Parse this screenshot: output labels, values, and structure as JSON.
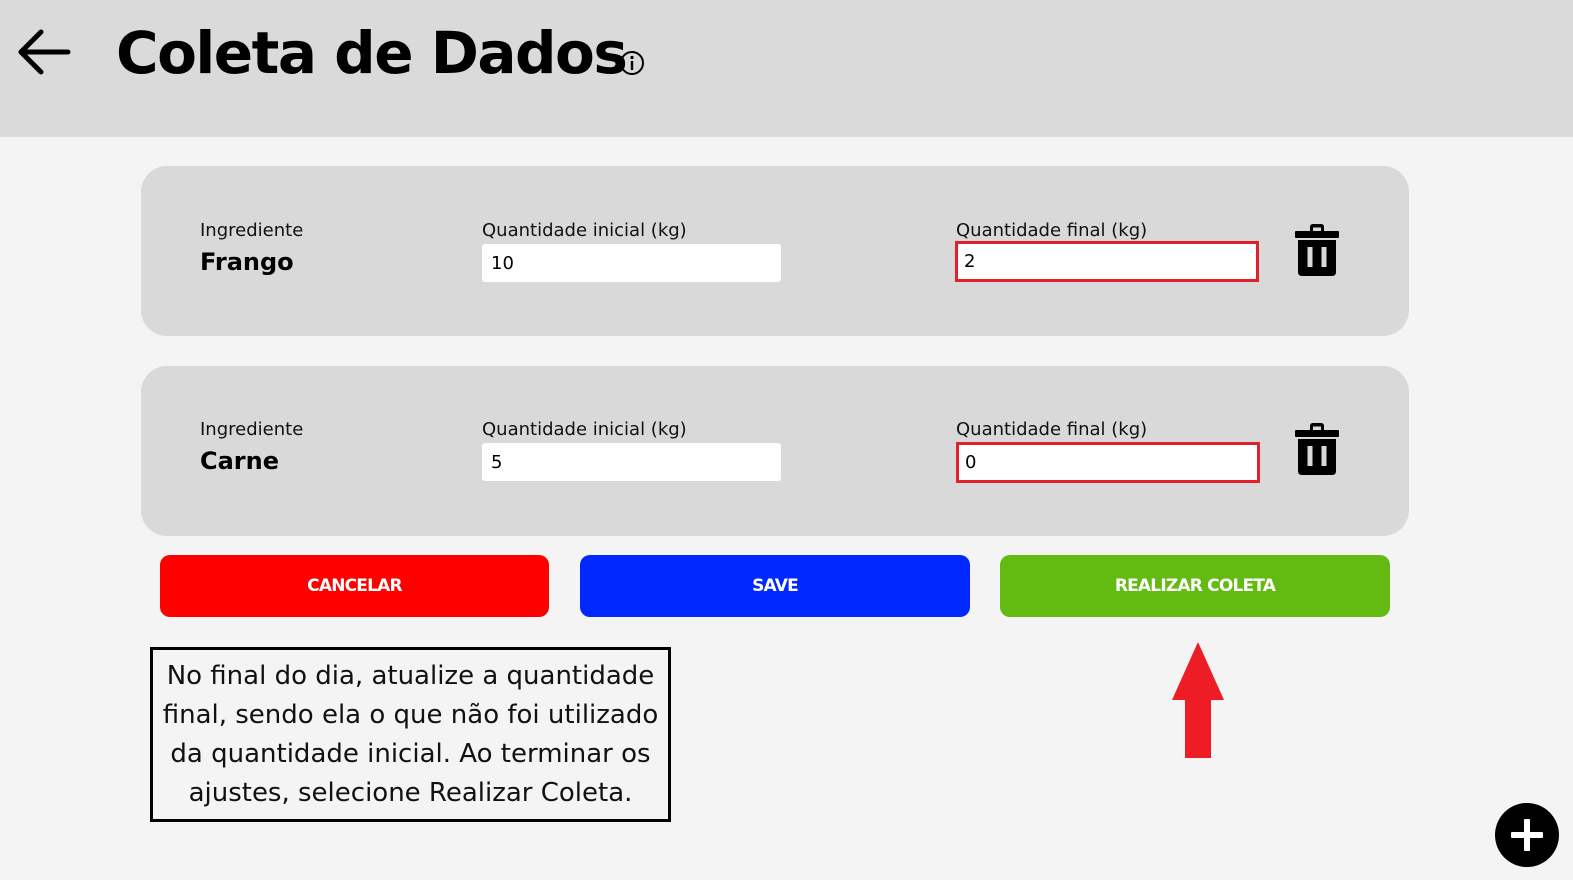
{
  "header": {
    "title": "Coleta de Dados",
    "back_icon": "arrow-left-icon",
    "info_icon": "info-icon"
  },
  "ingredients": [
    {
      "ingredient_label": "Ingrediente",
      "name": "Frango",
      "initial_label": "Quantidade inicial (kg)",
      "initial_value": "10",
      "final_label": "Quantidade final (kg)",
      "final_value": "2",
      "delete_icon": "trash-icon"
    },
    {
      "ingredient_label": "Ingrediente",
      "name": "Carne",
      "initial_label": "Quantidade inicial (kg)",
      "initial_value": "5",
      "final_label": "Quantidade final (kg)",
      "final_value": "0",
      "delete_icon": "trash-icon"
    }
  ],
  "actions": {
    "cancel_label": "CANCELAR",
    "save_label": "SAVE",
    "coleta_label": "REALIZAR COLETA"
  },
  "instruction": {
    "lines": [
      "No final do dia, atualize a quantidade",
      "final, sendo ela o que não foi utilizado",
      "da quantidade inicial. Ao terminar os",
      "ajustes, selecione Realizar Coleta."
    ]
  },
  "colors": {
    "header_bg": "#dadada",
    "card_bg": "#d9d9d9",
    "cancel": "#ff0000",
    "save": "#0028ff",
    "coleta": "#63bb12",
    "highlight": "#e0202a"
  },
  "fab_icon": "plus-icon"
}
